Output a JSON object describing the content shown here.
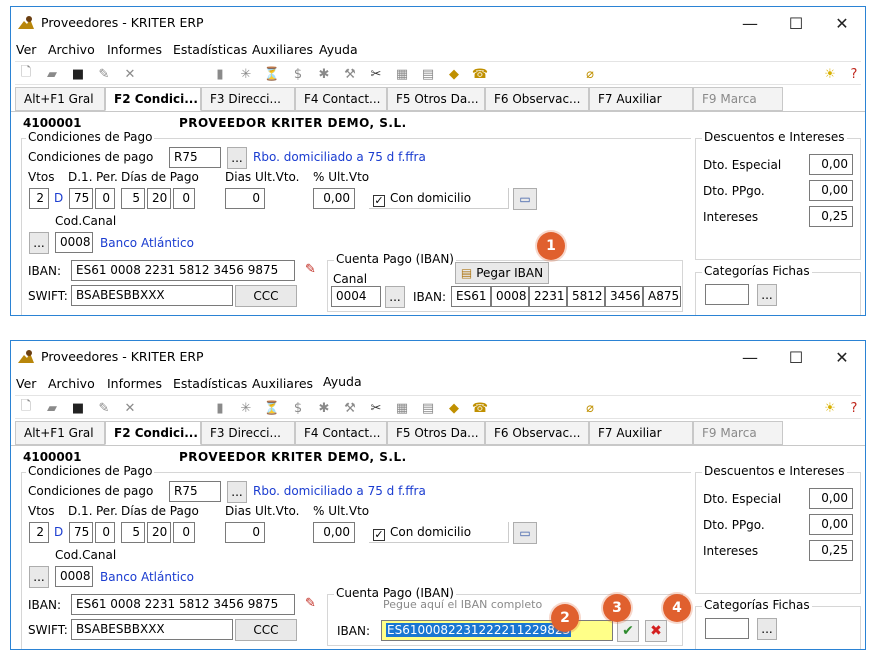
{
  "window": {
    "title": "Proveedores - KRITER ERP",
    "minimize": "—",
    "maximize": "☐",
    "close": "✕"
  },
  "menu": [
    "Ver",
    "Archivo",
    "Informes",
    "Estadísticas",
    "Auxiliares",
    "Ayuda"
  ],
  "tabs": [
    "Alt+F1 Gral",
    "F2 Condici...",
    "F3 Direcci...",
    "F4 Contact...",
    "F5 Otros Da...",
    "F6 Observac...",
    "F7 Auxiliar",
    "F9 Marca"
  ],
  "supplier": {
    "code": "4100001",
    "name": "PROVEEDOR KRITER DEMO, S.L."
  },
  "condiciones": {
    "group_title": "Condiciones de Pago",
    "label": "Condiciones de pago",
    "code": "R75",
    "lookup_button": "...",
    "description": "Rbo. domiciliado a 75 d f.ffra",
    "vtos_label": "Vtos",
    "d1_label": "D.1.",
    "per_label": "Per.",
    "dias_label": "Días de Pago",
    "dias_ult_label": "Dias Ult.Vto.",
    "pct_ult_label": "% Ult.Vto",
    "vtos": "2",
    "vtos_unit": "D",
    "d1": "75",
    "per": "0",
    "dias1": "5",
    "dias2": "20",
    "dias3": "0",
    "dias_ult": "0",
    "pct_ult": "0,00",
    "con_domicilio": "Con domicilio",
    "canal_label": "Cod.Canal",
    "canal_code": "0008",
    "canal_name": "Banco Atlántico"
  },
  "bank": {
    "iban_label": "IBAN:",
    "iban_value": "ES61 0008 2231 5812 3456 9875",
    "swift_label": "SWIFT:",
    "swift_value": "BSABESBBXXX",
    "ccc_button": "CCC"
  },
  "cuenta_pago": {
    "title": "Cuenta Pago (IBAN)",
    "pegar_button": "Pegar IBAN",
    "canal_label": "Canal",
    "canal_value": "0004",
    "iban_label": "IBAN:",
    "iban_parts": [
      "ES61",
      "0008",
      "2231",
      "5812",
      "3456",
      "A875"
    ],
    "paste_hint": "Pegue aquí el IBAN completo",
    "pasted_iban": "ES6100082231222211229823"
  },
  "descuentos": {
    "title": "Descuentos e Intereses",
    "dto_especial_label": "Dto. Especial",
    "dto_especial": "0,00",
    "dto_ppgo_label": "Dto. PPgo.",
    "dto_ppgo": "0,00",
    "intereses_label": "Intereses",
    "intereses": "0,25"
  },
  "categorias": {
    "title": "Categorías Fichas",
    "lookup_button": "..."
  },
  "callouts": [
    "1",
    "2",
    "3",
    "4"
  ],
  "accent_color": "#e0602e"
}
